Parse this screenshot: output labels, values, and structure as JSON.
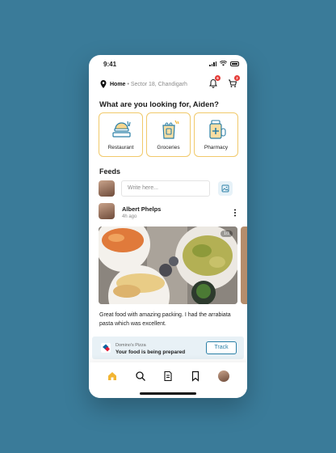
{
  "status": {
    "time": "9:41"
  },
  "location": {
    "label": "Home",
    "address": "• Sector 18, Chandigarh",
    "notification_badge": "6",
    "cart_badge": "2"
  },
  "headline": "What are you looking for, Aiden?",
  "categories": [
    {
      "label": "Restaurant",
      "icon": "restaurant-icon"
    },
    {
      "label": "Groceries",
      "icon": "groceries-icon"
    },
    {
      "label": "Pharmacy",
      "icon": "pharmacy-icon"
    }
  ],
  "feeds": {
    "title": "Feeds",
    "composer_placeholder": "Write here...",
    "post": {
      "author": "Albert Phelps",
      "time": "4h ago",
      "pager": "1/3",
      "caption": "Great food with amazing packing. I had the arrabiata pasta which was excellent."
    }
  },
  "order": {
    "shop": "Domino's Pizza",
    "status": "Your food is being prepared",
    "action": "Track"
  },
  "colors": {
    "accent": "#f2b533",
    "primary": "#2a7fa6",
    "background": "#3a7b99"
  }
}
